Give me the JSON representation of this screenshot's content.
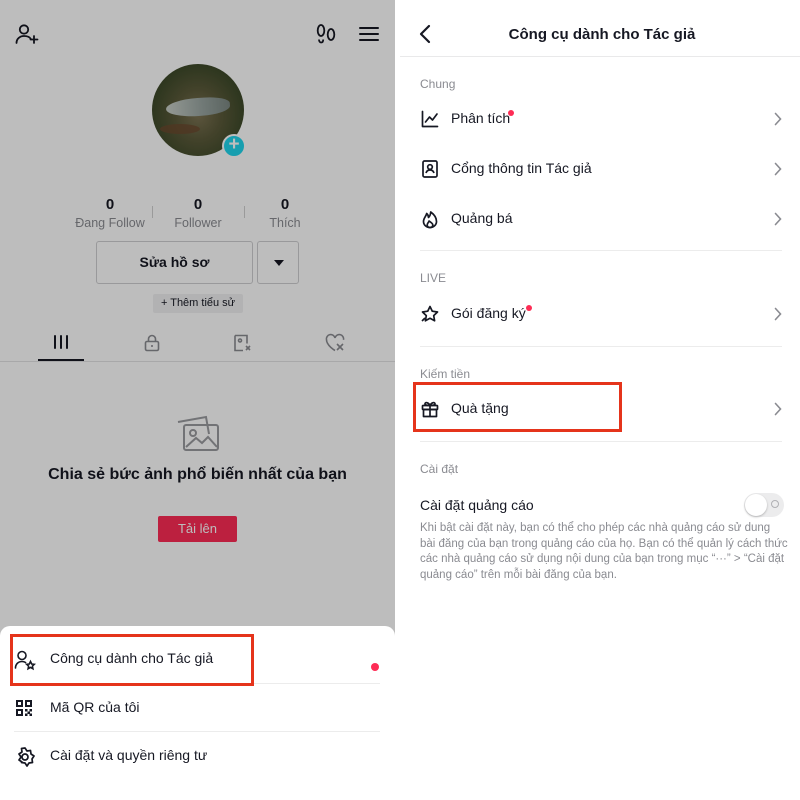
{
  "profile": {
    "stats": [
      {
        "value": "0",
        "label": "Đang Follow"
      },
      {
        "value": "0",
        "label": "Follower"
      },
      {
        "value": "0",
        "label": "Thích"
      }
    ],
    "edit_profile_label": "Sửa hồ sơ",
    "add_bio_label": "+ Thêm tiểu sử",
    "tabs": [
      "videos-grid-icon",
      "lock-icon",
      "tagged-icon",
      "liked-heart-icon"
    ],
    "empty_state": {
      "title": "Chia sẻ bức ảnh phổ biến nhất của bạn",
      "upload_label": "Tải lên"
    }
  },
  "bottom_sheet": {
    "items": [
      {
        "label": "Công cụ dành cho Tác giả",
        "icon": "creator-tools-icon",
        "has_dot": true
      },
      {
        "label": "Mã QR của tôi",
        "icon": "qr-code-icon"
      },
      {
        "label": "Cài đặt và quyền riêng tư",
        "icon": "settings-gear-icon"
      }
    ]
  },
  "creator_tools": {
    "title": "Công cụ dành cho Tác giả",
    "sections": [
      {
        "label": "Chung",
        "items": [
          {
            "label": "Phân tích",
            "icon": "analytics-icon",
            "has_dot": true
          },
          {
            "label": "Cổng thông tin Tác giả",
            "icon": "portal-icon"
          },
          {
            "label": "Quảng bá",
            "icon": "flame-icon"
          }
        ]
      },
      {
        "label": "LIVE",
        "items": [
          {
            "label": "Gói đăng ký",
            "icon": "subscription-star-icon",
            "has_dot": true
          }
        ]
      },
      {
        "label": "Kiếm tiền",
        "items": [
          {
            "label": "Quà tặng",
            "icon": "gift-icon"
          }
        ]
      },
      {
        "label": "Cài đặt",
        "items": []
      }
    ],
    "ads_setting": {
      "label": "Cài đặt quảng cáo",
      "enabled": false,
      "description": "Khi bật cài đặt này, bạn có thể cho phép các nhà quảng cáo sử dung bài đăng của bạn trong quảng cáo của họ. Bạn có thể quản lý cách thức các nhà quảng cáo sử dụng nội dung của bạn trong mục “···” > “Cài đặt quảng cáo” trên mỗi bài đăng của bạn."
    }
  },
  "colors": {
    "accent": "#fe2c55",
    "highlight": "#e5341b",
    "avatar_plus": "#20d5ec"
  }
}
